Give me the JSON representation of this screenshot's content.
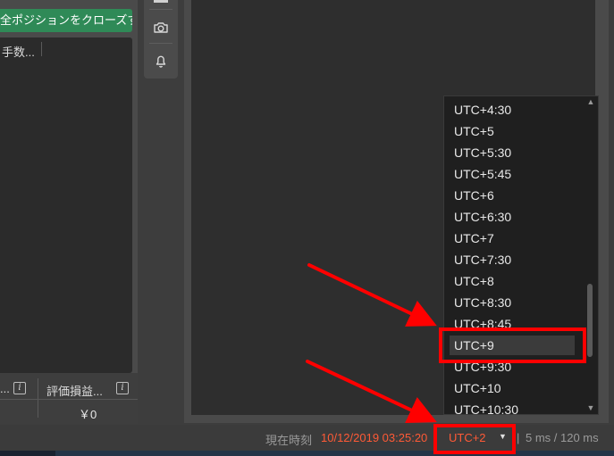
{
  "left_panel": {
    "close_all_label": "全ポジションをクローズする",
    "column_header": "手数...",
    "summary": {
      "left_label": "...",
      "right_label": "評価損益...",
      "right_value": "￥0",
      "info_icon_glyph": "i"
    }
  },
  "toolbar": {
    "icons": [
      "menu-icon",
      "camera-icon",
      "bell-icon"
    ]
  },
  "timezone_dropdown": {
    "scroll_up_glyph": "▲",
    "scroll_down_glyph": "▼",
    "selected": "UTC+9",
    "options": [
      "UTC+4:30",
      "UTC+5",
      "UTC+5:30",
      "UTC+5:45",
      "UTC+6",
      "UTC+6:30",
      "UTC+7",
      "UTC+7:30",
      "UTC+8",
      "UTC+8:30",
      "UTC+8:45",
      "UTC+9",
      "UTC+9:30",
      "UTC+10",
      "UTC+10:30"
    ]
  },
  "statusbar": {
    "current_time_label": "現在時刻",
    "current_time_value": "10/12/2019 03:25:20",
    "timezone_value": "UTC+2",
    "caret_glyph": "▼",
    "separator": "|",
    "latency": "5 ms / 120 ms"
  },
  "colors": {
    "accent_green": "#2f8a57",
    "time_orange": "#ff5a36",
    "annotation_red": "#ff0000"
  }
}
